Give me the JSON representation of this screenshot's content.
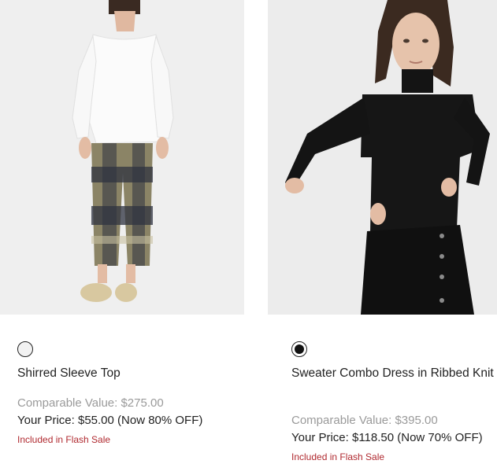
{
  "products": [
    {
      "name": "Shirred Sleeve Top",
      "swatch_color": "#f2f2f2",
      "comparable_value": "Comparable Value: $275.00",
      "your_price": "Your Price: $55.00 (Now 80% OFF)",
      "flash_sale": "Included in Flash Sale"
    },
    {
      "name": "Sweater Combo Dress in Ribbed Knit",
      "swatch_color": "#111111",
      "comparable_value": "Comparable Value: $395.00",
      "your_price": "Your Price: $118.50 (Now 70% OFF)",
      "flash_sale": "Included in Flash Sale"
    }
  ],
  "colors": {
    "flash_sale_text": "#b02a30",
    "muted_price": "#9a9a9a"
  }
}
